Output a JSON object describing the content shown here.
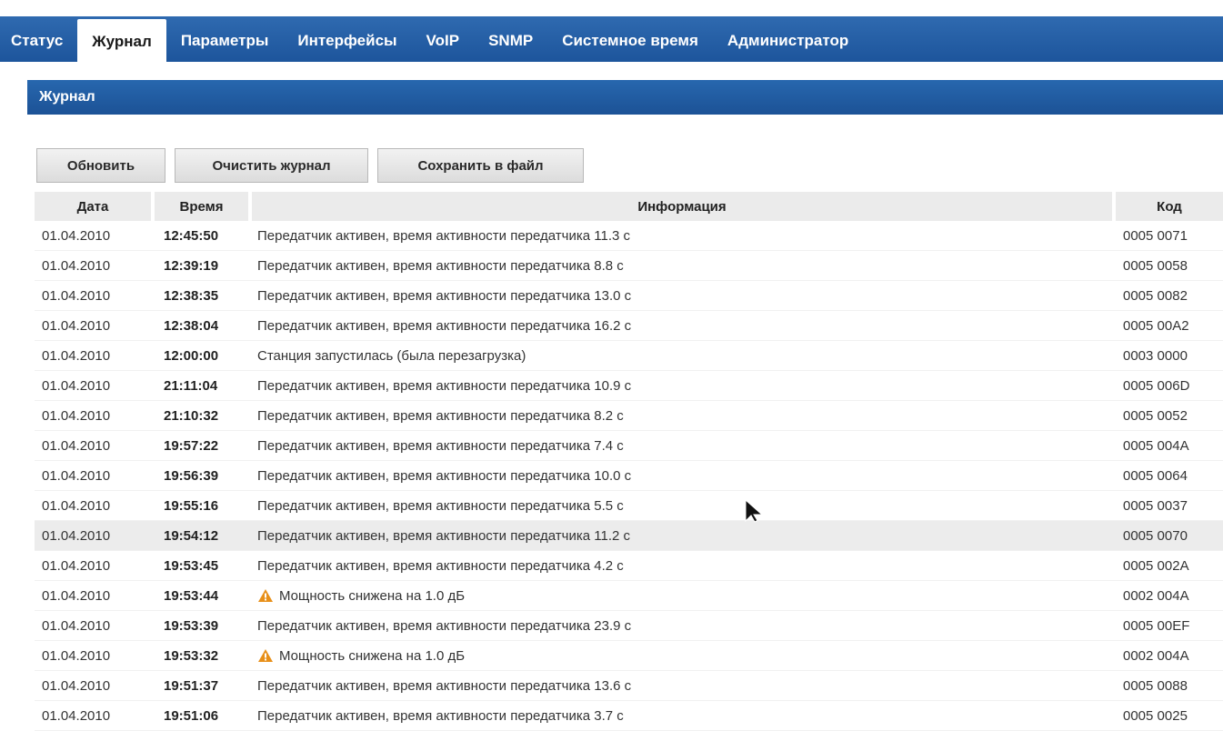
{
  "nav": {
    "tabs": [
      {
        "label": "Статус"
      },
      {
        "label": "Журнал"
      },
      {
        "label": "Параметры"
      },
      {
        "label": "Интерфейсы"
      },
      {
        "label": "VoIP"
      },
      {
        "label": "SNMP"
      },
      {
        "label": "Системное время"
      },
      {
        "label": "Администратор"
      }
    ],
    "active_tab": "Журнал"
  },
  "panel": {
    "title": "Журнал"
  },
  "toolbar": {
    "refresh_label": "Обновить",
    "clear_label": "Очистить журнал",
    "save_label": "Сохранить в файл"
  },
  "table": {
    "columns": [
      "Дата",
      "Время",
      "Информация",
      "Код"
    ],
    "rows": [
      {
        "date": "01.04.2010",
        "time": "12:45:50",
        "info": "Передатчик активен, время активности передатчика 11.3 с",
        "code": "0005 0071"
      },
      {
        "date": "01.04.2010",
        "time": "12:39:19",
        "info": "Передатчик активен, время активности передатчика 8.8 с",
        "code": "0005 0058"
      },
      {
        "date": "01.04.2010",
        "time": "12:38:35",
        "info": "Передатчик активен, время активности передатчика 13.0 с",
        "code": "0005 0082"
      },
      {
        "date": "01.04.2010",
        "time": "12:38:04",
        "info": "Передатчик активен, время активности передатчика 16.2 с",
        "code": "0005 00A2"
      },
      {
        "date": "01.04.2010",
        "time": "12:00:00",
        "info": "Станция запустилась (была перезагрузка)",
        "code": "0003 0000"
      },
      {
        "date": "01.04.2010",
        "time": "21:11:04",
        "info": "Передатчик активен, время активности передатчика 10.9 с",
        "code": "0005 006D"
      },
      {
        "date": "01.04.2010",
        "time": "21:10:32",
        "info": "Передатчик активен, время активности передатчика 8.2 с",
        "code": "0005 0052"
      },
      {
        "date": "01.04.2010",
        "time": "19:57:22",
        "info": "Передатчик активен, время активности передатчика 7.4 с",
        "code": "0005 004A"
      },
      {
        "date": "01.04.2010",
        "time": "19:56:39",
        "info": "Передатчик активен, время активности передатчика 10.0 с",
        "code": "0005 0064"
      },
      {
        "date": "01.04.2010",
        "time": "19:55:16",
        "info": "Передатчик активен, время активности передатчика 5.5 с",
        "code": "0005 0037"
      },
      {
        "date": "01.04.2010",
        "time": "19:54:12",
        "info": "Передатчик активен, время активности передатчика 11.2 с",
        "code": "0005 0070",
        "highlight": true
      },
      {
        "date": "01.04.2010",
        "time": "19:53:45",
        "info": "Передатчик активен, время активности передатчика 4.2 с",
        "code": "0005 002A"
      },
      {
        "date": "01.04.2010",
        "time": "19:53:44",
        "info": "Мощность снижена на 1.0 дБ",
        "code": "0002 004A",
        "icon": "warning-icon"
      },
      {
        "date": "01.04.2010",
        "time": "19:53:39",
        "info": "Передатчик активен, время активности передатчика 23.9 с",
        "code": "0005 00EF"
      },
      {
        "date": "01.04.2010",
        "time": "19:53:32",
        "info": "Мощность снижена на 1.0 дБ",
        "code": "0002 004A",
        "icon": "warning-icon"
      },
      {
        "date": "01.04.2010",
        "time": "19:51:37",
        "info": "Передатчик активен, время активности передатчика 13.6 с",
        "code": "0005 0088"
      },
      {
        "date": "01.04.2010",
        "time": "19:51:06",
        "info": "Передатчик активен, время активности передатчика 3.7 с",
        "code": "0005 0025"
      }
    ]
  },
  "colors": {
    "nav_bg": "#1d559c",
    "header_bg": "#2767ae",
    "warning": "#e8901a"
  }
}
